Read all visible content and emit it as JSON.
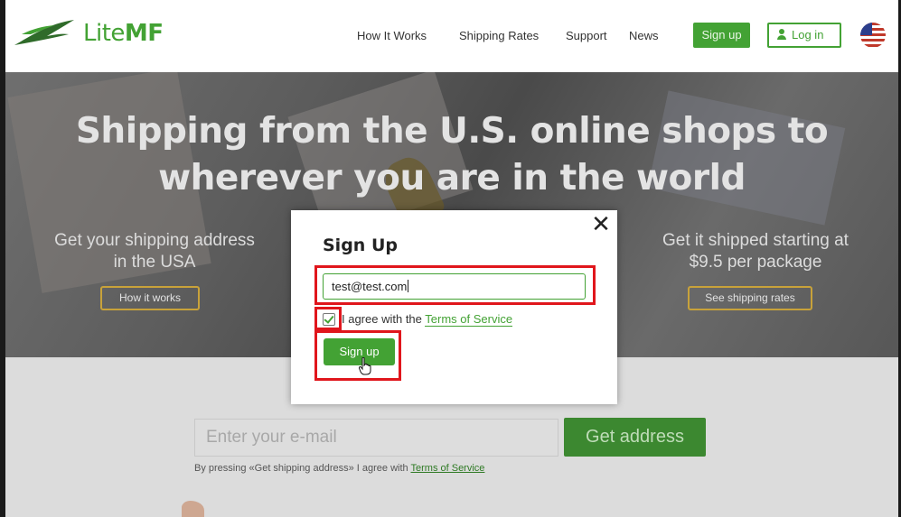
{
  "brand": {
    "name_light": "Lite",
    "name_bold": "MF"
  },
  "nav": {
    "items": [
      "How It Works",
      "Shipping Rates",
      "Support",
      "News"
    ],
    "signup_label": "Sign up",
    "login_label": "Log in"
  },
  "hero": {
    "title_line1": "Shipping from the U.S. online shops to",
    "title_line2": "wherever you are in the world",
    "left_line1": "Get your shipping address",
    "left_line2": "in the USA",
    "left_button": "How it works",
    "right_line1": "Get it shipped starting at",
    "right_line2": "$9.5 per package",
    "right_button": "See shipping rates"
  },
  "signup_strip": {
    "email_placeholder": "Enter your e-mail",
    "button_label": "Get address",
    "fine_print": "By pressing «Get shipping address» I agree with ",
    "tos_link": "Terms of Service"
  },
  "modal": {
    "title": "Sign Up",
    "email_value": "test@test.com",
    "checkbox_checked": true,
    "agree_text": "I agree with the ",
    "tos_link": "Terms of Service",
    "submit_label": "Sign up",
    "close_glyph": "✕"
  },
  "colors": {
    "brand_green": "#43a234",
    "highlight_red": "#e0161c"
  }
}
